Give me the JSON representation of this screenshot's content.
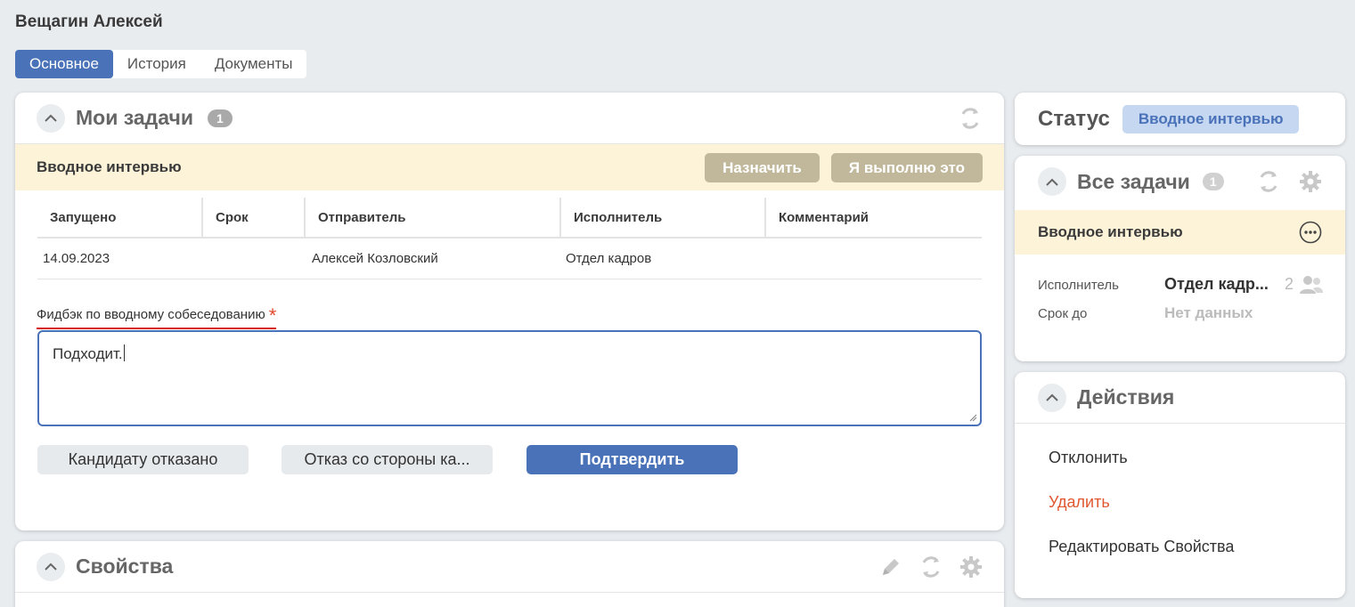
{
  "page": {
    "title": "Вещагин Алексей"
  },
  "tabs": [
    {
      "label": "Основное",
      "active": true
    },
    {
      "label": "История",
      "active": false
    },
    {
      "label": "Документы",
      "active": false
    }
  ],
  "my_tasks": {
    "title": "Мои задачи",
    "count": "1",
    "task": {
      "title": "Вводное интервью",
      "assign_label": "Назначить",
      "take_label": "Я выполню это"
    },
    "columns": [
      "Запущено",
      "Срок",
      "Отправитель",
      "Исполнитель",
      "Комментарий"
    ],
    "rows": [
      [
        "14.09.2023",
        "",
        "Алексей Козловский",
        "Отдел кадров",
        ""
      ]
    ],
    "feedback": {
      "label": "Фидбэк по вводному собеседованию",
      "required_mark": "*",
      "value": "Подходит."
    },
    "buttons": {
      "rejected": "Кандидату отказано",
      "candidate_refused": "Отказ со стороны ка...",
      "confirm": "Подтвердить"
    }
  },
  "properties": {
    "title": "Свойства"
  },
  "status": {
    "label": "Статус",
    "value": "Вводное интервью"
  },
  "all_tasks": {
    "title": "Все задачи",
    "count": "1",
    "task_title": "Вводное интервью",
    "assignee_label": "Исполнитель",
    "assignee_value": "Отдел кадр...",
    "assignee_count": "2",
    "due_label": "Срок до",
    "due_value": "Нет данных"
  },
  "actions": {
    "title": "Действия",
    "items": [
      {
        "label": "Отклонить"
      },
      {
        "label": "Удалить"
      },
      {
        "label": "Редактировать Свойства"
      }
    ]
  },
  "colors": {
    "accent": "#4a72b8",
    "band": "#fdf3d8",
    "band_button": "#c1b89b",
    "danger": "#e0572f",
    "required": "#d62020"
  }
}
